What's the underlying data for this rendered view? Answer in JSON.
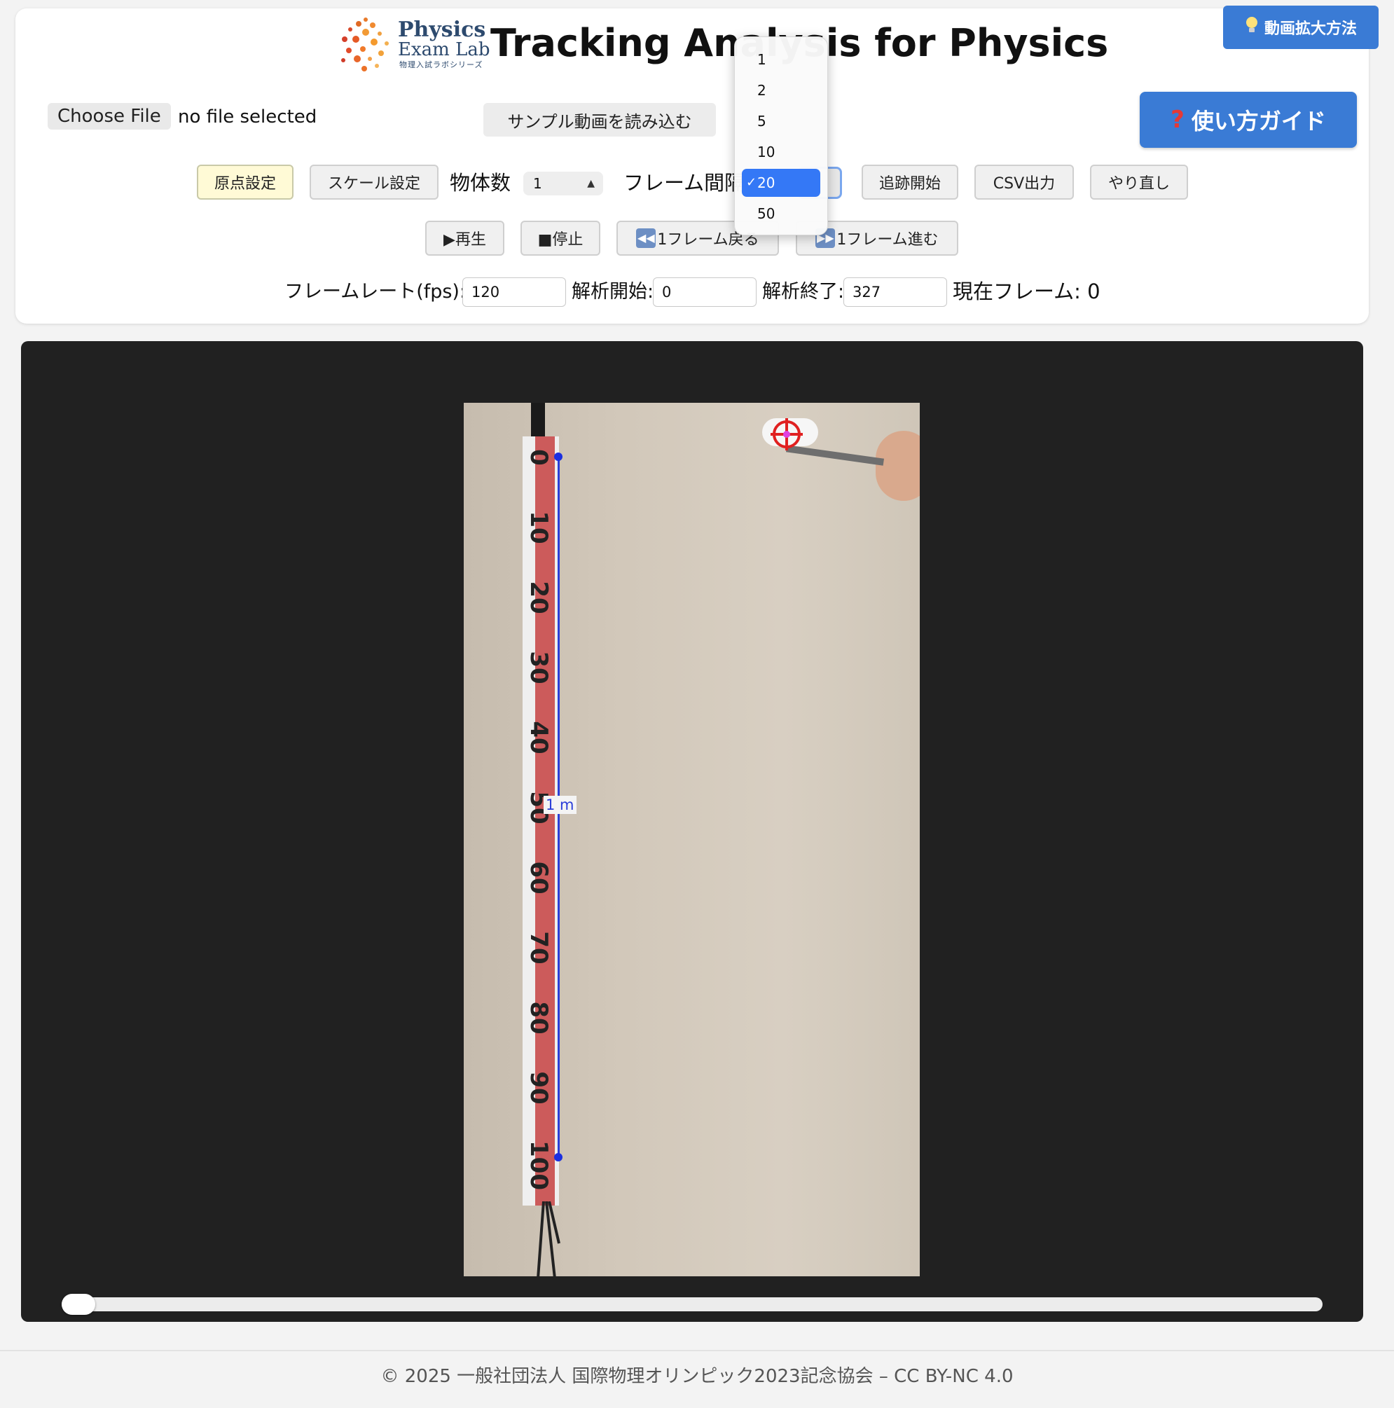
{
  "header": {
    "logo_line1": "Physics",
    "logo_line2": "Exam Lab",
    "logo_line3": "物理入試ラボシリーズ",
    "title": "Tracking Analysis for Physics",
    "zoom_button_label": "動画拡大方法",
    "guide_button_label": "使い方ガイド"
  },
  "file": {
    "choose_label": "Choose File",
    "status": "no file selected",
    "sample_button": "サンプル動画を読み込む"
  },
  "toolbar": {
    "origin_button": "原点設定",
    "scale_button": "スケール設定",
    "object_count_label": "物体数",
    "object_count_value": "1",
    "frame_interval_label": "フレーム間隔",
    "track_button": "追跡開始",
    "csv_button": "CSV出力",
    "reset_button": "やり直し"
  },
  "playback": {
    "play_button": "▶再生",
    "stop_button": "■停止",
    "back_button": "1フレーム戻る",
    "forward_button": "1フレーム進む"
  },
  "params": {
    "fps_label": "フレームレート(fps):",
    "fps_value": "120",
    "start_label": "解析開始:",
    "start_value": "0",
    "end_label": "解析終了:",
    "end_value": "327",
    "current_frame_label": "現在フレーム:",
    "current_frame_value": "0"
  },
  "frame_interval_dropdown": {
    "options": [
      "1",
      "2",
      "5",
      "10",
      "20",
      "50"
    ],
    "selected": "20"
  },
  "video": {
    "scale_label": "1 m",
    "ruler_marks": [
      "0",
      "10",
      "20",
      "30",
      "40",
      "50",
      "60",
      "70",
      "80",
      "90",
      "100"
    ]
  },
  "timeline": {
    "position_fraction": 0.0
  },
  "footer": {
    "text": "© 2025 一般社団法人 国際物理オリンピック2023記念協会 – CC BY-NC 4.0"
  },
  "colors": {
    "accent_blue": "#3a7bd5",
    "select_blue": "#3478f6",
    "origin_highlight": "#fffad6",
    "stage_bg": "#212121",
    "ruler_red": "#c84a4a",
    "marker_red": "#e02020"
  }
}
